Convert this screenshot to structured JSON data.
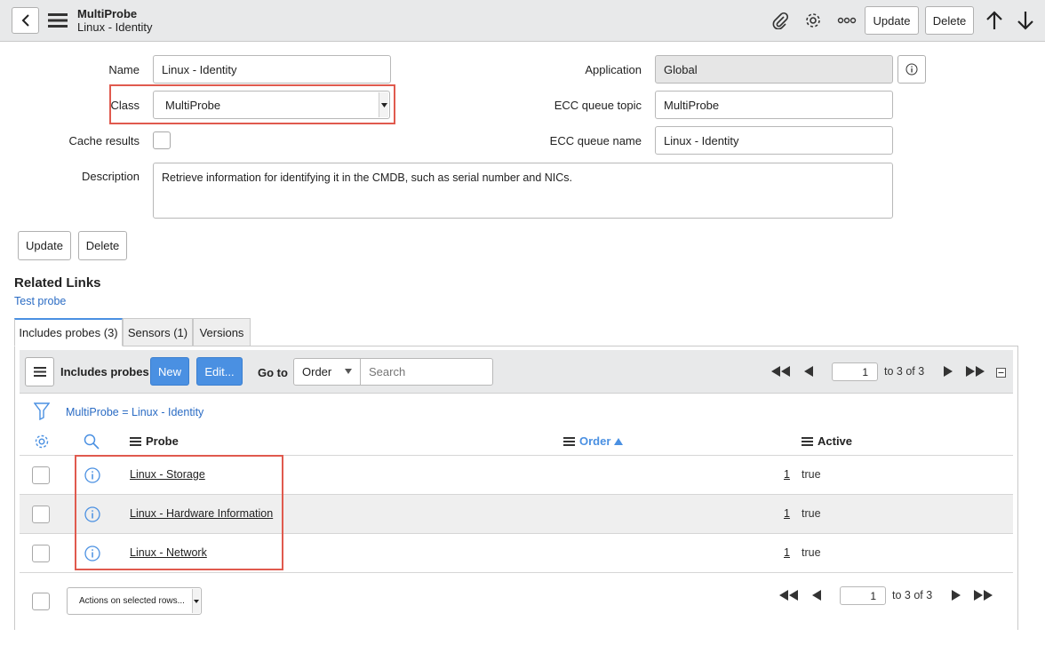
{
  "header": {
    "title": "MultiProbe",
    "subtitle": "Linux - Identity",
    "update_label": "Update",
    "delete_label": "Delete"
  },
  "form": {
    "name_label": "Name",
    "name_value": "Linux - Identity",
    "class_label": "Class",
    "class_value": "MultiProbe",
    "cache_label": "Cache results",
    "description_label": "Description",
    "description_value": "Retrieve information for identifying it in the CMDB, such as serial number and NICs.",
    "application_label": "Application",
    "application_value": "Global",
    "ecc_topic_label": "ECC queue topic",
    "ecc_topic_value": "MultiProbe",
    "ecc_name_label": "ECC queue name",
    "ecc_name_value": "Linux - Identity",
    "update_label": "Update",
    "delete_label": "Delete"
  },
  "related_links": {
    "title": "Related Links",
    "test_probe": "Test probe"
  },
  "tabs": [
    {
      "label": "Includes probes (3)"
    },
    {
      "label": "Sensors (1)"
    },
    {
      "label": "Versions"
    }
  ],
  "list": {
    "title": "Includes probes",
    "new_label": "New",
    "edit_label": "Edit...",
    "goto_label": "Go to",
    "goto_field": "Order",
    "search_placeholder": "Search",
    "page_value": "1",
    "range_text": "to 3 of 3",
    "filter_text": "MultiProbe = Linux - Identity",
    "columns": {
      "probe": "Probe",
      "order": "Order",
      "active": "Active"
    },
    "rows": [
      {
        "probe": "Linux - Storage",
        "order": "1",
        "active": "true"
      },
      {
        "probe": "Linux - Hardware Information",
        "order": "1",
        "active": "true"
      },
      {
        "probe": "Linux - Network",
        "order": "1",
        "active": "true"
      }
    ],
    "actions_label": "Actions on selected rows..."
  },
  "colors": {
    "accent": "#4a90e2",
    "highlight": "#e05a4e",
    "link": "#2b6cc4"
  }
}
